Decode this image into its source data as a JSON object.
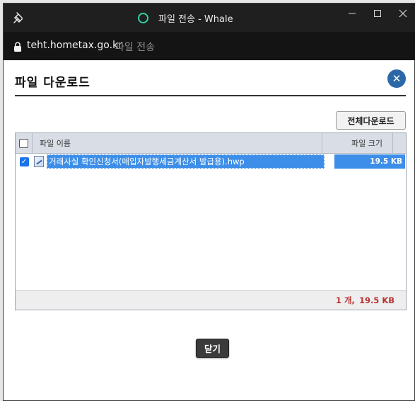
{
  "window": {
    "title": "파일 전송 - Whale",
    "controls": {
      "minimize": "—",
      "maximize": "☐",
      "close": "✕"
    },
    "icons": {
      "pin": "pin-icon",
      "loading": "loading-icon",
      "lock": "lock-icon"
    }
  },
  "urlbar": {
    "domain": "teht.hometax.go.kr",
    "page_title": "파일 전송"
  },
  "dialog": {
    "title": "파일 다운로드",
    "close_symbol": "✕",
    "download_all_label": "전체다운로드",
    "close_button_label": "닫기"
  },
  "grid": {
    "columns": {
      "name": "파일 이름",
      "size": "파일 크기"
    },
    "rows": [
      {
        "checked": true,
        "name": "거래사실 확인신청서(매입자발행세금계산서 발급용).hwp",
        "size": "19.5 KB"
      }
    ],
    "footer": {
      "count": "1 개,",
      "total_size": "19.5 KB"
    }
  },
  "colors": {
    "accent": "#2c68a8",
    "selection": "#3d8ee8",
    "footer_text": "#b73232",
    "spinner": "#2fd0a6"
  }
}
